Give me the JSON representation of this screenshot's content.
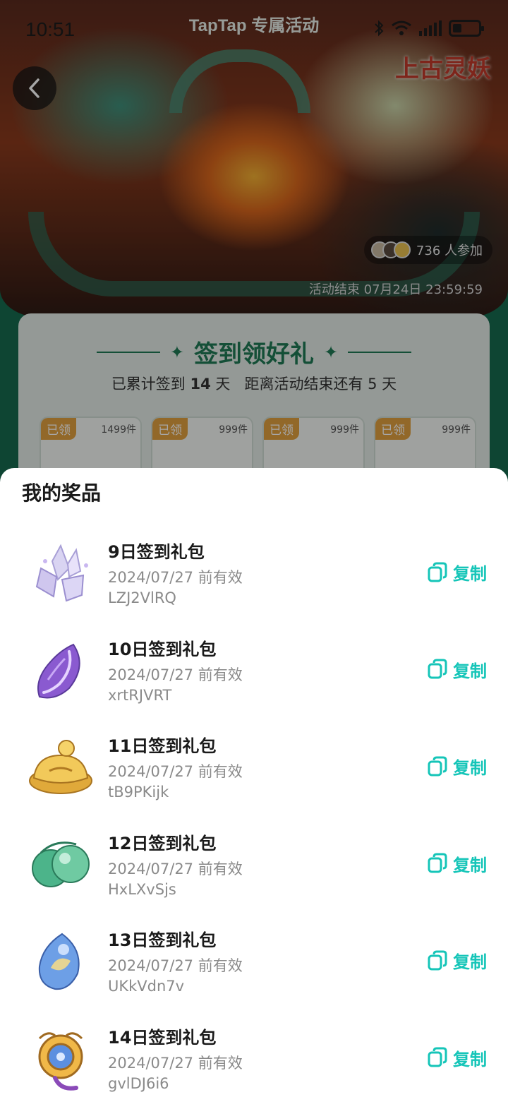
{
  "status_bar": {
    "time": "10:51",
    "title": "TapTap 专属活动"
  },
  "hero": {
    "logo_text": "上古灵妖",
    "participants": "736 人参加",
    "end_time": "活动结束 07月24日 23:59:59"
  },
  "signin": {
    "title": "签到领好礼",
    "days_prefix": "已累计签到",
    "days_count": "14",
    "days_suffix": "天",
    "remaining": "距离活动结束还有 5 天",
    "tiles": [
      {
        "status": "已领",
        "qty": "1499件"
      },
      {
        "status": "已领",
        "qty": "999件"
      },
      {
        "status": "已领",
        "qty": "999件"
      },
      {
        "status": "已领",
        "qty": "999件"
      }
    ]
  },
  "sheet": {
    "title": "我的奖品",
    "copy_label": "复制",
    "prizes": [
      {
        "name": "9日签到礼包",
        "valid": "2024/07/27 前有效",
        "code": "LZJ2VlRQ",
        "icon": "crystal-cluster-icon"
      },
      {
        "name": "10日签到礼包",
        "valid": "2024/07/27 前有效",
        "code": "xrtRJVRT",
        "icon": "purple-feather-icon"
      },
      {
        "name": "11日签到礼包",
        "valid": "2024/07/27 前有效",
        "code": "tB9PKijk",
        "icon": "gold-ingot-icon"
      },
      {
        "name": "12日签到礼包",
        "valid": "2024/07/27 前有效",
        "code": "HxLXvSjs",
        "icon": "jade-orbs-icon"
      },
      {
        "name": "13日签到礼包",
        "valid": "2024/07/27 前有效",
        "code": "UKkVdn7v",
        "icon": "blue-gem-icon"
      },
      {
        "name": "14日签到礼包",
        "valid": "2024/07/27 前有效",
        "code": "gvlDJ6i6",
        "icon": "golden-ornament-icon"
      }
    ]
  },
  "colors": {
    "accent": "#15c5b8",
    "brand_green": "#1f7a55",
    "muted_text": "#8a8a8a"
  }
}
